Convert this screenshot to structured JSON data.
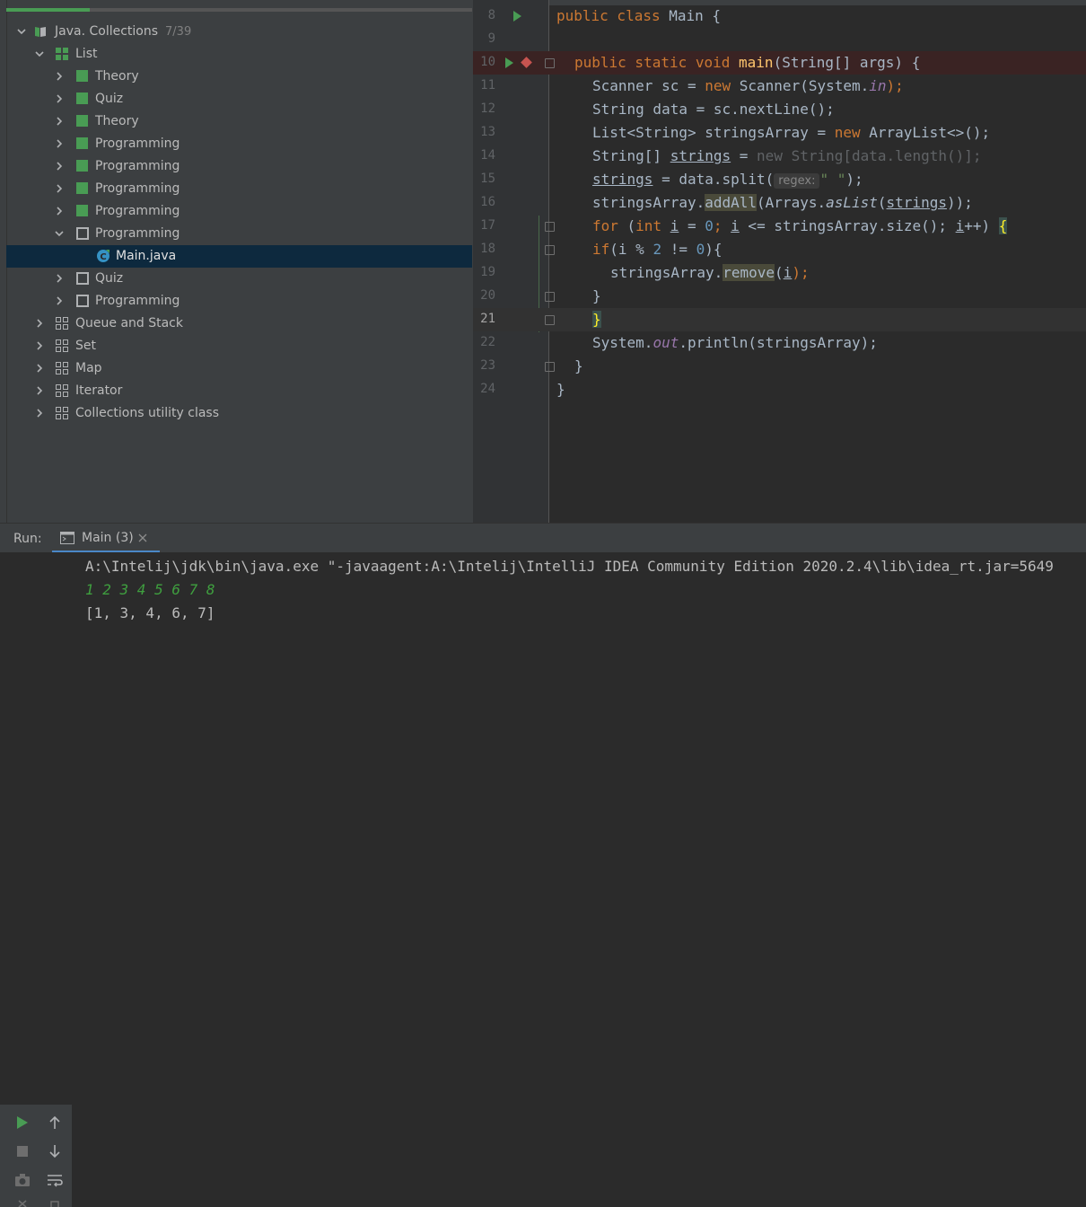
{
  "project": {
    "root": {
      "label": "Java. Collections",
      "count": "7/39"
    },
    "items": [
      {
        "label": "List",
        "icon": "module-grid-green-icon"
      },
      {
        "label": "Theory",
        "icon": "task-solved-icon"
      },
      {
        "label": "Quiz",
        "icon": "task-solved-icon"
      },
      {
        "label": "Theory",
        "icon": "task-solved-icon"
      },
      {
        "label": "Programming",
        "icon": "task-solved-icon"
      },
      {
        "label": "Programming",
        "icon": "task-solved-icon"
      },
      {
        "label": "Programming",
        "icon": "task-solved-icon"
      },
      {
        "label": "Programming",
        "icon": "task-solved-icon"
      },
      {
        "label": "Programming",
        "icon": "task-unsolved-icon"
      },
      {
        "label": "Main.java",
        "icon": "java-class-icon"
      },
      {
        "label": "Quiz",
        "icon": "task-unsolved-icon"
      },
      {
        "label": "Programming",
        "icon": "task-unsolved-icon"
      },
      {
        "label": "Queue and Stack",
        "icon": "module-grid-icon"
      },
      {
        "label": "Set",
        "icon": "module-grid-icon"
      },
      {
        "label": "Map",
        "icon": "module-grid-icon"
      },
      {
        "label": "Iterator",
        "icon": "module-grid-icon"
      },
      {
        "label": "Collections utility class",
        "icon": "module-grid-icon"
      }
    ]
  },
  "editor": {
    "line_numbers": [
      "8",
      "9",
      "10",
      "11",
      "12",
      "13",
      "14",
      "15",
      "16",
      "17",
      "18",
      "19",
      "20",
      "21",
      "22",
      "23",
      "24"
    ],
    "current_line": "21",
    "param_hint": "regex:",
    "code": {
      "l8": [
        "public class ",
        "Main",
        " {"
      ],
      "l10": [
        "public static void ",
        "main",
        "(String[] args) {"
      ],
      "l11": [
        "Scanner sc = ",
        "new ",
        "Scanner(System.",
        "in",
        ");"
      ],
      "l12": [
        "String data = sc.nextLine();"
      ],
      "l13": [
        "List<String> stringsArray = ",
        "new ",
        "ArrayList<>();"
      ],
      "l14": [
        "String[] ",
        "strings",
        " = ",
        "new String[data.length()];"
      ],
      "l15": [
        "strings",
        " = data.split(",
        "\" \"",
        ");"
      ],
      "l16": [
        "stringsArray.",
        "addAll",
        "(Arrays.",
        "asList",
        "(",
        "strings",
        "));"
      ],
      "l17": [
        "for ",
        "(",
        "int ",
        "i",
        " = ",
        "0",
        "; ",
        "i",
        " <= stringsArray.size(); ",
        "i",
        "++) ",
        "{"
      ],
      "l18": [
        "if",
        "(i % ",
        "2",
        " != ",
        "0",
        "){"
      ],
      "l19": [
        "stringsArray.",
        "remove",
        "(",
        "i",
        ");"
      ],
      "l20": [
        "}"
      ],
      "l21": [
        "}"
      ],
      "l22": [
        "System.",
        "out",
        ".println(stringsArray);"
      ],
      "l23": [
        "}"
      ],
      "l24": [
        "}"
      ]
    }
  },
  "run": {
    "label": "Run:",
    "tab": "Main (3)",
    "output": [
      "A:\\Intelij\\jdk\\bin\\java.exe \"-javaagent:A:\\Intelij\\IntelliJ IDEA Community Edition 2020.2.4\\lib\\idea_rt.jar=5649",
      "1 2 3 4 5 6 7 8",
      "[1, 3, 4, 6, 7]"
    ]
  },
  "colors": {
    "accent_green": "#499c54",
    "selection": "#0d293e",
    "keyword": "#cc7832",
    "function": "#ffc66d",
    "number": "#6897bb",
    "string": "#6a8759",
    "field": "#9876aa",
    "input_text": "#3f9f3f"
  }
}
